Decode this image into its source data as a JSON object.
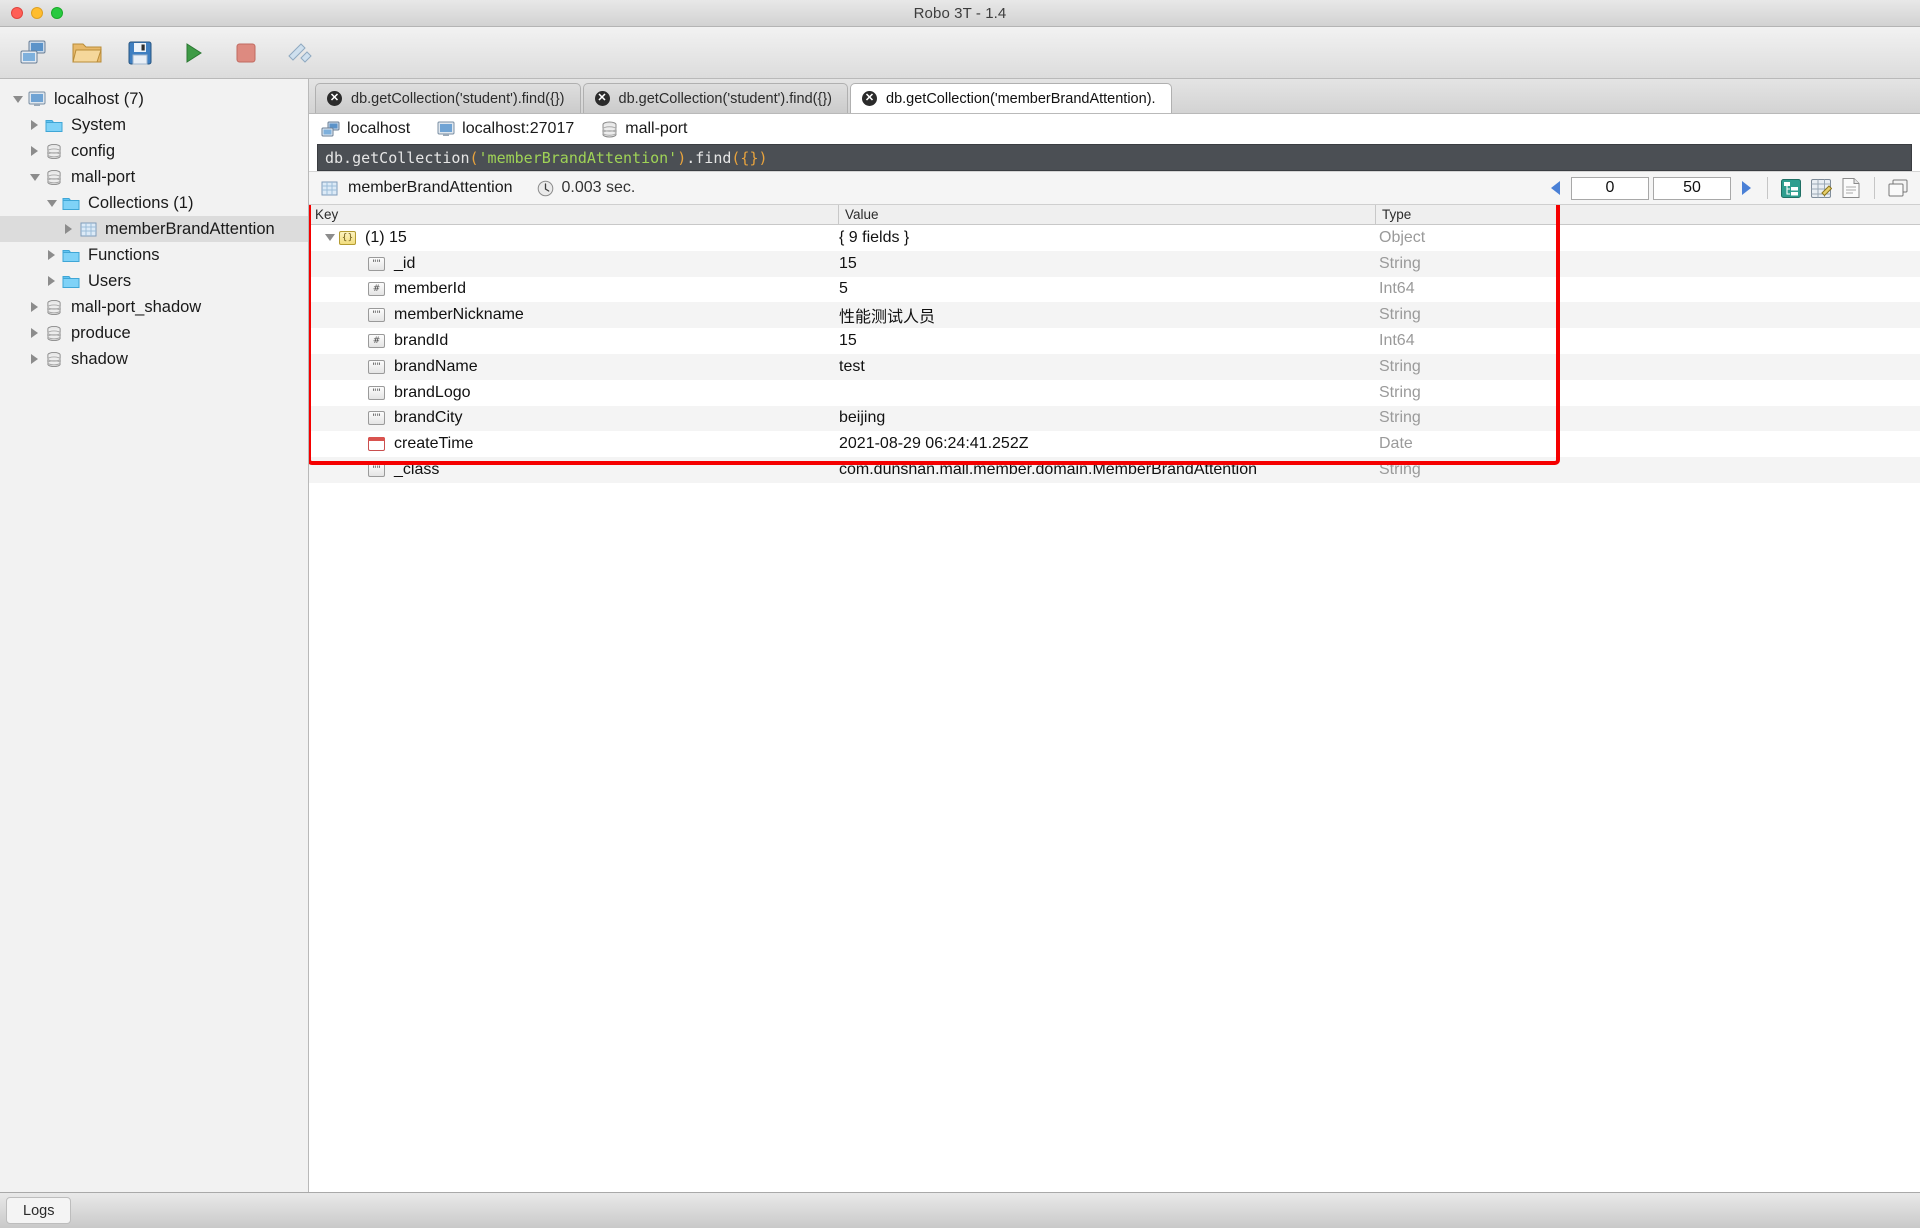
{
  "window": {
    "title": "Robo 3T - 1.4",
    "traffic_lights": [
      "close",
      "minimize",
      "maximize"
    ]
  },
  "toolbar": {
    "buttons": [
      {
        "name": "connect-button",
        "icon": "connect-icon",
        "label": "Connect"
      },
      {
        "name": "open-file-button",
        "icon": "folder-icon",
        "label": "Open Script"
      },
      {
        "name": "save-file-button",
        "icon": "floppy-disk-icon",
        "label": "Save"
      },
      {
        "name": "execute-button",
        "icon": "play-icon",
        "label": "Execute"
      },
      {
        "name": "stop-button",
        "icon": "stop-icon",
        "label": "Stop"
      },
      {
        "name": "refresh-button",
        "icon": "refresh-icon",
        "label": "Refresh"
      }
    ]
  },
  "sidebar": {
    "items": [
      {
        "label": "localhost (7)",
        "icon": "server-icon",
        "indent": 0,
        "twisty": "open",
        "selected": false
      },
      {
        "label": "System",
        "icon": "folder-icon",
        "indent": 1,
        "twisty": "closed",
        "selected": false
      },
      {
        "label": "config",
        "icon": "database-icon",
        "indent": 1,
        "twisty": "closed",
        "selected": false
      },
      {
        "label": "mall-port",
        "icon": "database-icon",
        "indent": 1,
        "twisty": "open",
        "selected": false
      },
      {
        "label": "Collections (1)",
        "icon": "folder-icon",
        "indent": 2,
        "twisty": "open",
        "selected": false
      },
      {
        "label": "memberBrandAttention",
        "icon": "collection-icon",
        "indent": 3,
        "twisty": "closed",
        "selected": true
      },
      {
        "label": "Functions",
        "icon": "folder-icon",
        "indent": 2,
        "twisty": "closed",
        "selected": false
      },
      {
        "label": "Users",
        "icon": "folder-icon",
        "indent": 2,
        "twisty": "closed",
        "selected": false
      },
      {
        "label": "mall-port_shadow",
        "icon": "database-icon",
        "indent": 1,
        "twisty": "closed",
        "selected": false
      },
      {
        "label": "produce",
        "icon": "database-icon",
        "indent": 1,
        "twisty": "closed",
        "selected": false
      },
      {
        "label": "shadow",
        "icon": "database-icon",
        "indent": 1,
        "twisty": "closed",
        "selected": false
      }
    ]
  },
  "tabs": [
    {
      "label": "db.getCollection('student').find({})",
      "active": false
    },
    {
      "label": "db.getCollection('student').find({})",
      "active": false
    },
    {
      "label": "db.getCollection('memberBrandAttention).",
      "active": true
    }
  ],
  "connection_bar": {
    "connection": "localhost",
    "host": "localhost:27017",
    "database": "mall-port"
  },
  "query": {
    "prefix": "db.getCollection",
    "open_paren": "(",
    "string": "'memberBrandAttention'",
    "close_paren": ")",
    "dot_find": ".find",
    "args": "({})"
  },
  "results_toolbar": {
    "collection": "memberBrandAttention",
    "elapsed": "0.003 sec.",
    "page_skip": "0",
    "page_limit": "50",
    "view_buttons": [
      {
        "name": "tree-view-button",
        "label": "Tree view"
      },
      {
        "name": "table-view-button",
        "label": "Table view"
      },
      {
        "name": "text-view-button",
        "label": "Text view"
      },
      {
        "name": "detach-view-button",
        "label": "Detach"
      }
    ]
  },
  "table": {
    "headers": {
      "key": "Key",
      "value": "Value",
      "type": "Type"
    },
    "rows": [
      {
        "key": "(1) 15",
        "value": "{ 9 fields }",
        "type": "Object",
        "icon": "object-icon",
        "indent": 0,
        "twisty": "open"
      },
      {
        "key": "_id",
        "value": "15",
        "type": "String",
        "icon": "string-icon",
        "indent": 1,
        "twisty": "none"
      },
      {
        "key": "memberId",
        "value": "5",
        "type": "Int64",
        "icon": "number-icon",
        "indent": 1,
        "twisty": "none"
      },
      {
        "key": "memberNickname",
        "value": "性能测试人员",
        "type": "String",
        "icon": "string-icon",
        "indent": 1,
        "twisty": "none"
      },
      {
        "key": "brandId",
        "value": "15",
        "type": "Int64",
        "icon": "number-icon",
        "indent": 1,
        "twisty": "none"
      },
      {
        "key": "brandName",
        "value": "test",
        "type": "String",
        "icon": "string-icon",
        "indent": 1,
        "twisty": "none"
      },
      {
        "key": "brandLogo",
        "value": "",
        "type": "String",
        "icon": "string-icon",
        "indent": 1,
        "twisty": "none"
      },
      {
        "key": "brandCity",
        "value": "beijing",
        "type": "String",
        "icon": "string-icon",
        "indent": 1,
        "twisty": "none"
      },
      {
        "key": "createTime",
        "value": "2021-08-29 06:24:41.252Z",
        "type": "Date",
        "icon": "date-icon",
        "indent": 1,
        "twisty": "none"
      },
      {
        "key": "_class",
        "value": "com.dunshan.mall.member.domain.MemberBrandAttention",
        "type": "String",
        "icon": "string-icon",
        "indent": 1,
        "twisty": "none"
      }
    ]
  },
  "status_bar": {
    "logs_label": "Logs"
  },
  "colors": {
    "highlight_box": "#f50000",
    "accent_blue": "#4a80d6",
    "query_bg": "#4b4f54",
    "query_string": "#9fd356",
    "query_paren": "#e8a33d"
  }
}
